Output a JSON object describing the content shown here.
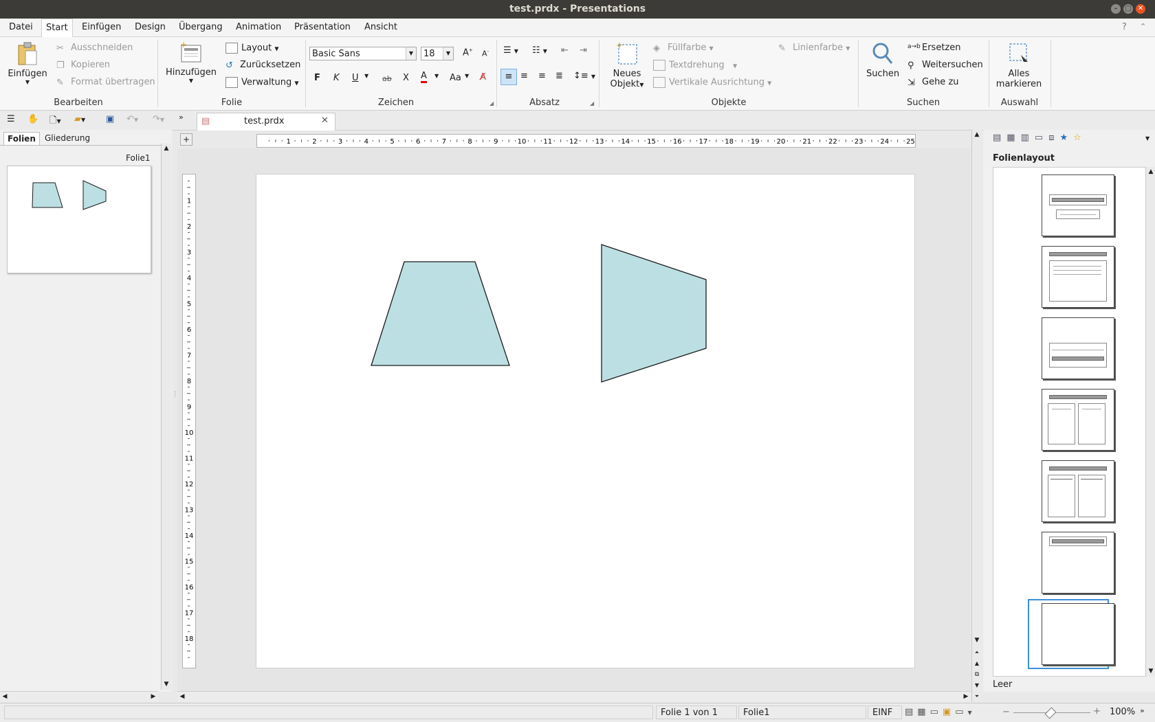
{
  "window": {
    "title": "test.prdx - Presentations"
  },
  "menu": [
    "Datei",
    "Start",
    "Einfügen",
    "Design",
    "Übergang",
    "Animation",
    "Präsentation",
    "Ansicht"
  ],
  "ribbon": {
    "clipboard": {
      "paste": "Einfügen",
      "cut": "Ausschneiden",
      "copy": "Kopieren",
      "format_painter": "Format übertragen",
      "group": "Bearbeiten"
    },
    "slide": {
      "add": "Hinzufügen",
      "layout": "Layout",
      "reset": "Zurücksetzen",
      "manage": "Verwaltung",
      "group": "Folie"
    },
    "font": {
      "name": "Basic Sans",
      "size": "18",
      "bold": "F",
      "italic": "K",
      "underline": "U",
      "strike": "ab",
      "clear": "X",
      "color": "A",
      "case": "Aa",
      "group": "Zeichen"
    },
    "paragraph": {
      "group": "Absatz"
    },
    "objects": {
      "new_object_1": "Neues",
      "new_object_2": "Objekt",
      "fill": "Füllfarbe",
      "rotate": "Textdrehung",
      "valign": "Vertikale Ausrichtung",
      "line_color": "Linienfarbe",
      "group": "Objekte"
    },
    "search": {
      "search": "Suchen",
      "replace": "Ersetzen",
      "find_next": "Weitersuchen",
      "goto": "Gehe zu",
      "group": "Suchen"
    },
    "select": {
      "select_all_1": "Alles",
      "select_all_2": "markieren",
      "group": "Auswahl"
    }
  },
  "doc_tab": {
    "name": "test.prdx"
  },
  "left_panel": {
    "tabs": [
      "Folien",
      "Gliederung"
    ],
    "slide_label": "Folie1"
  },
  "ruler": {
    "h_ticks": [
      "1",
      "2",
      "3",
      "4",
      "5",
      "6",
      "7",
      "8",
      "9",
      "10",
      "11",
      "12",
      "13",
      "14",
      "15",
      "16",
      "17",
      "18",
      "19",
      "20",
      "21",
      "22",
      "23",
      "24",
      "25"
    ],
    "v_ticks": [
      "1",
      "2",
      "3",
      "4",
      "5",
      "6",
      "7",
      "8",
      "9",
      "10",
      "11",
      "12",
      "13",
      "14",
      "15",
      "16",
      "17",
      "18"
    ]
  },
  "shapes": {
    "fill": "#bcdfe3",
    "stroke": "#1a1a1a"
  },
  "right_pane": {
    "title": "Folienlayout",
    "selected_layout": "Leer"
  },
  "status": {
    "slide_position": "Folie 1 von 1",
    "slide_name": "Folie1",
    "mode": "EINF",
    "zoom": "100%"
  }
}
